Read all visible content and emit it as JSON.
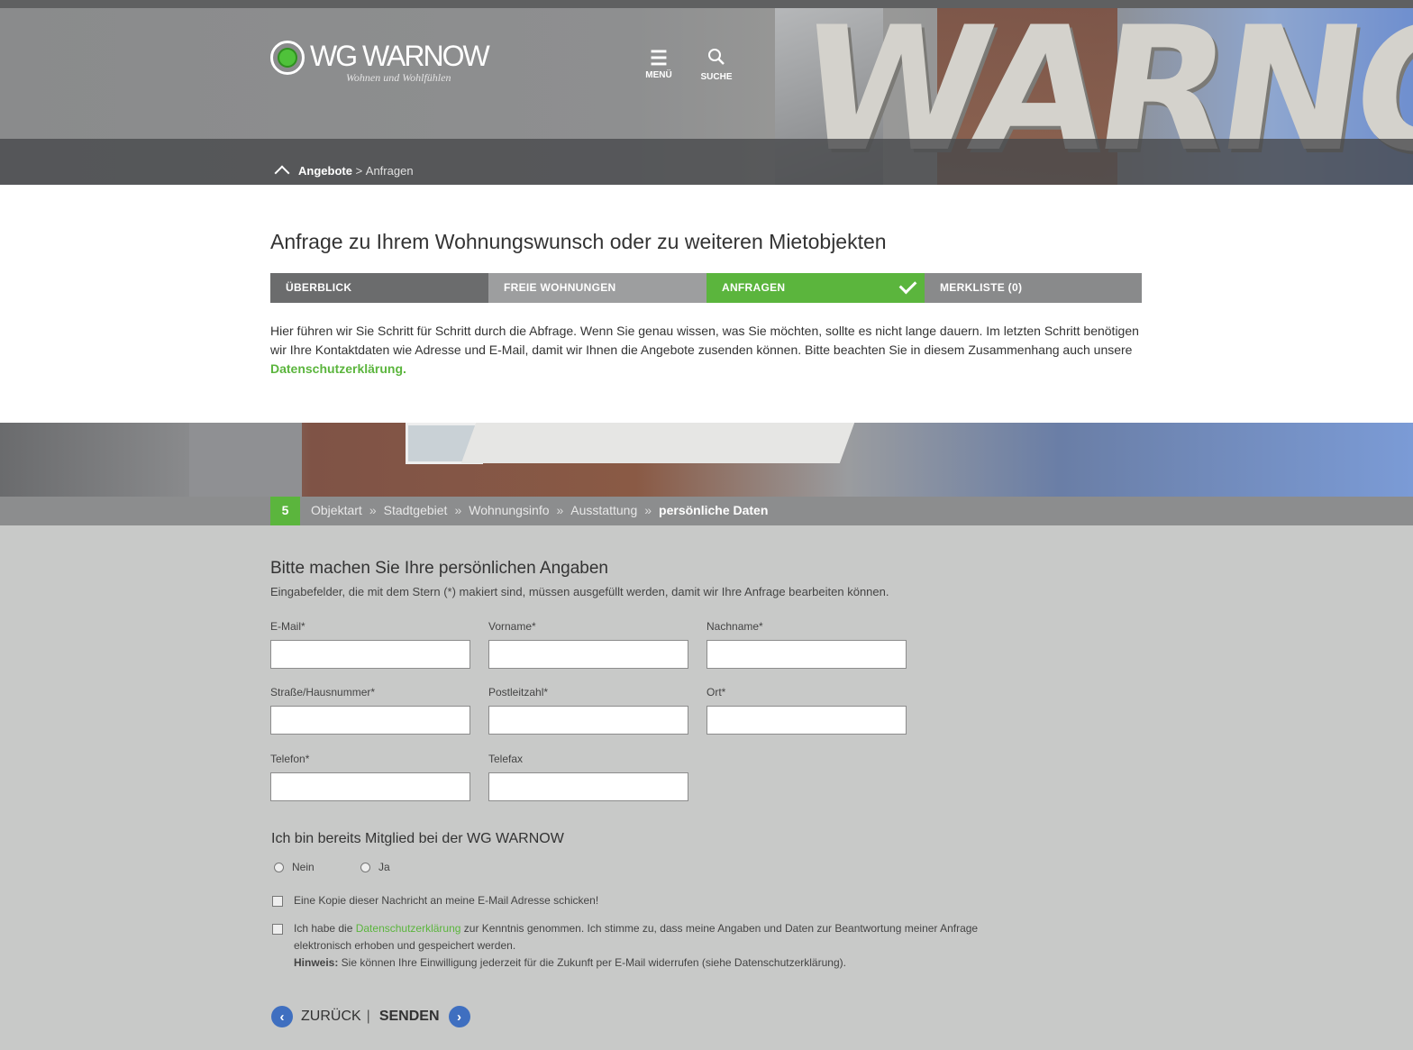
{
  "header": {
    "logo_name": "WG WARNOW",
    "logo_slogan": "Wohnen und Wohlfühlen",
    "menu_label": "MENÜ",
    "search_label": "SUCHE",
    "hero_lettering": "WARNO",
    "breadcrumb": {
      "parent": "Angebote",
      "separator": " > ",
      "current": "Anfragen"
    }
  },
  "main": {
    "title": "Anfrage zu Ihrem Wohnungswunsch oder zu weiteren Mietobjekten",
    "tabs": [
      {
        "label": "ÜBERBLICK"
      },
      {
        "label": "FREIE WOHNUNGEN"
      },
      {
        "label": "ANFRAGEN",
        "active": true
      },
      {
        "label": "MERKLISTE (0)"
      }
    ],
    "intro_text": "Hier führen wir Sie Schritt für Schritt durch die Abfrage. Wenn Sie genau wissen, was Sie möchten, sollte es nicht lange dauern. Im letzten Schritt benötigen wir Ihre Kontaktdaten wie Adresse und E-Mail, damit wir Ihnen die Angebote zusenden können. Bitte beachten Sie in diesem Zusammenhang auch unsere ",
    "intro_link": "Datenschutzerklärung",
    "intro_end": "."
  },
  "steps": {
    "number": "5",
    "items": [
      "Objektart",
      "Stadtgebiet",
      "Wohnungsinfo",
      "Ausstattung",
      "persönliche Daten"
    ],
    "separator": "»"
  },
  "form": {
    "title": "Bitte machen Sie Ihre persönlichen Angaben",
    "subtitle": "Eingabefelder, die mit dem Stern (*) makiert sind, müssen ausgefüllt werden, damit wir Ihre Anfrage bearbeiten können.",
    "fields": {
      "email": {
        "label": "E-Mail*",
        "value": ""
      },
      "vorname": {
        "label": "Vorname*",
        "value": ""
      },
      "nachname": {
        "label": "Nachname*",
        "value": ""
      },
      "strasse": {
        "label": "Straße/Hausnummer*",
        "value": ""
      },
      "plz": {
        "label": "Postleitzahl*",
        "value": ""
      },
      "ort": {
        "label": "Ort*",
        "value": ""
      },
      "telefon": {
        "label": "Telefon*",
        "value": ""
      },
      "telefax": {
        "label": "Telefax",
        "value": ""
      }
    },
    "member_question": "Ich bin bereits Mitglied bei der WG WARNOW",
    "radio_no": "Nein",
    "radio_yes": "Ja",
    "copy_checkbox": "Eine Kopie dieser Nachricht an meine E-Mail Adresse schicken!",
    "privacy_pre": "Ich habe die ",
    "privacy_link": "Datenschutzerklärung",
    "privacy_post": " zur Kenntnis genommen. Ich stimme zu, dass meine Angaben und Daten zur Beantwortung meiner Anfrage elektronisch erhoben und gespeichert werden.",
    "hint_label": "Hinweis:",
    "hint_text": " Sie können Ihre Einwilligung jederzeit für die Zukunft per E-Mail widerrufen (siehe Datenschutzerklärung).",
    "back_label": "ZURÜCK",
    "divider": "|",
    "send_label": "SENDEN"
  },
  "colors": {
    "accent_green": "#5bb53d",
    "button_blue": "#3f6fc0",
    "form_bg": "#c8c9c8"
  }
}
